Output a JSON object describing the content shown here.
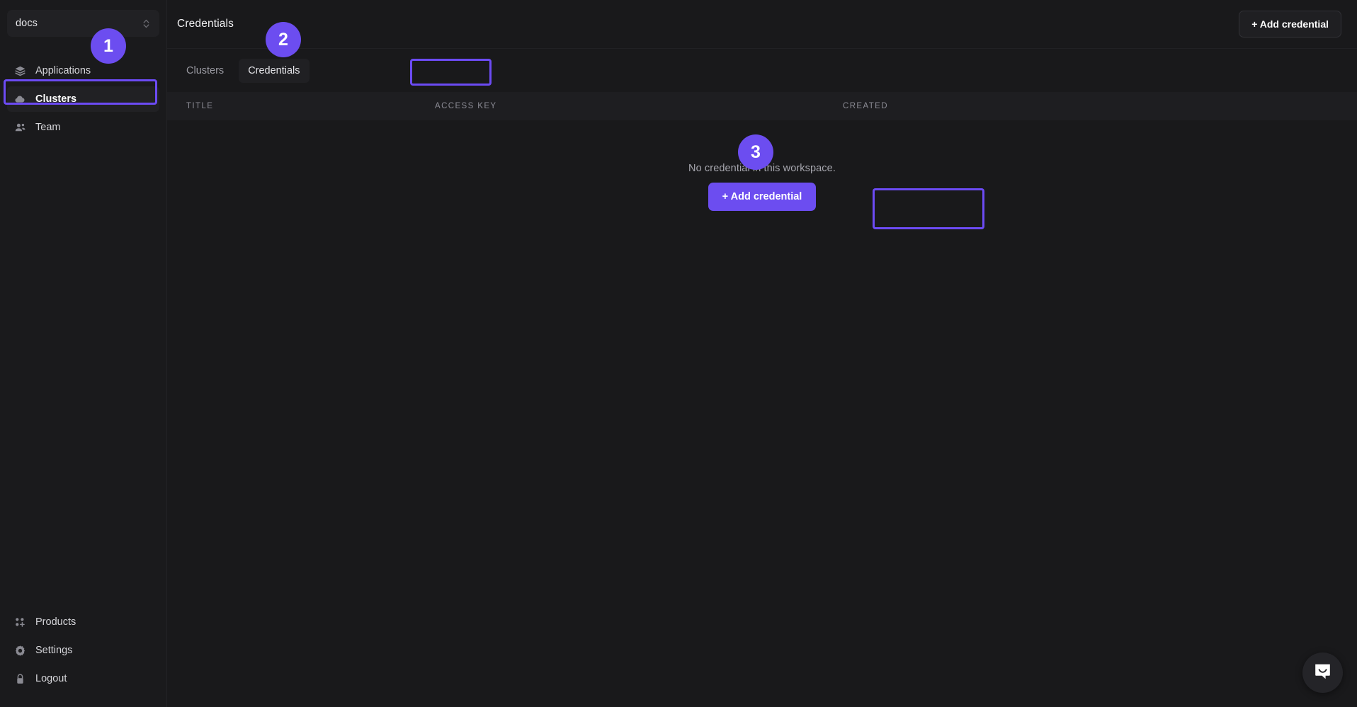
{
  "sidebar": {
    "workspace": {
      "name": "docs",
      "selector_icon": "chevron-up-down-icon"
    },
    "primary_items": [
      {
        "label": "Applications",
        "icon": "layers-icon",
        "active": false
      },
      {
        "label": "Clusters",
        "icon": "cloud-icon",
        "active": true
      },
      {
        "label": "Team",
        "icon": "users-icon",
        "active": false
      }
    ],
    "bottom_items": [
      {
        "label": "Products",
        "icon": "grid-plus-icon"
      },
      {
        "label": "Settings",
        "icon": "gear-icon"
      },
      {
        "label": "Logout",
        "icon": "lock-icon"
      }
    ]
  },
  "header": {
    "title": "Credentials",
    "add_credential_label": "+ Add credential"
  },
  "tabs": [
    {
      "label": "Clusters",
      "active": false
    },
    {
      "label": "Credentials",
      "active": true
    }
  ],
  "table": {
    "columns": [
      "TITLE",
      "ACCESS KEY",
      "CREATED"
    ],
    "rows": []
  },
  "empty_state": {
    "message": "No credential in this workspace.",
    "add_credential_label": "+ Add credential"
  },
  "chat": {
    "icon": "intercom-chat-icon"
  },
  "annotations": [
    {
      "number": "1",
      "target": "sidebar-item-clusters"
    },
    {
      "number": "2",
      "target": "tab-credentials"
    },
    {
      "number": "3",
      "target": "empty-state-add-credential-button"
    }
  ],
  "colors": {
    "accent": "#6c4df0",
    "annotation": "#6c4bf4",
    "background": "#19191b",
    "sidebar": "#1a1a1c",
    "table_header": "#1e1e21"
  }
}
